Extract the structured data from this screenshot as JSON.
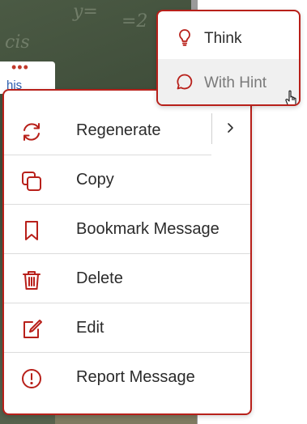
{
  "background": {
    "chalk_a": "y=",
    "chalk_b": "=2",
    "chalk_c": "cis",
    "card_dots": "•••",
    "card_link_fragment": "his"
  },
  "menu": {
    "accent_color": "#b8201a",
    "items": [
      {
        "label": "Regenerate",
        "icon": "refresh-icon",
        "has_submenu": true
      },
      {
        "label": "Copy",
        "icon": "copy-icon"
      },
      {
        "label": "Bookmark Message",
        "icon": "bookmark-icon"
      },
      {
        "label": "Delete",
        "icon": "trash-icon"
      },
      {
        "label": "Edit",
        "icon": "edit-icon"
      },
      {
        "label": "Report Message",
        "icon": "alert-circle-icon"
      }
    ]
  },
  "submenu": {
    "items": [
      {
        "label": "Think",
        "icon": "lightbulb-icon"
      },
      {
        "label": "With Hint",
        "icon": "chat-bubble-icon",
        "hovered": true
      }
    ]
  }
}
